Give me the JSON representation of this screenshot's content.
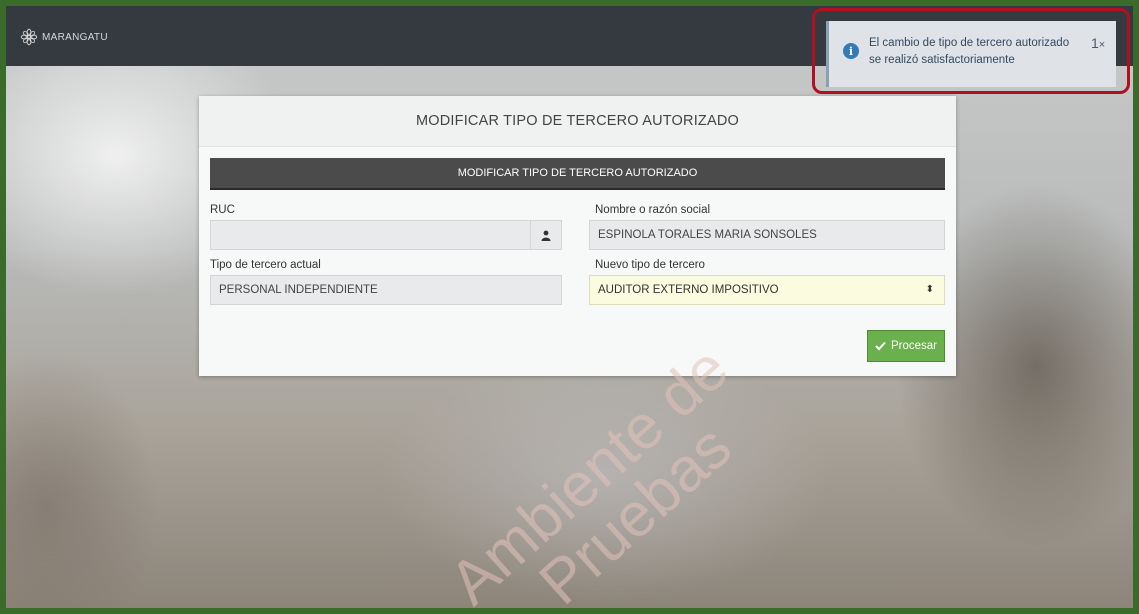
{
  "app": {
    "logo_text": "MARANGATU"
  },
  "toast": {
    "message": "El cambio de tipo de tercero autorizado se realizó satisfactoriamente",
    "count": "1",
    "close_glyph": "×",
    "icon": "info-icon"
  },
  "card": {
    "title": "MODIFICAR TIPO DE TERCERO AUTORIZADO",
    "section_title": "MODIFICAR TIPO DE TERCERO AUTORIZADO"
  },
  "form": {
    "ruc_label": "RUC",
    "ruc_value": "",
    "name_label": "Nombre o razón social",
    "name_value": "ESPINOLA TORALES MARIA SONSOLES",
    "current_type_label": "Tipo de tercero actual",
    "current_type_value": "PERSONAL INDEPENDIENTE",
    "new_type_label": "Nuevo tipo de tercero",
    "new_type_value": "AUDITOR EXTERNO IMPOSITIVO"
  },
  "actions": {
    "process_label": "Procesar"
  },
  "watermark": {
    "line1": "Ambiente de",
    "line2": "Pruebas"
  },
  "colors": {
    "accent": "#6ab04c",
    "topbar": "#343a40",
    "highlight": "#b01020"
  }
}
